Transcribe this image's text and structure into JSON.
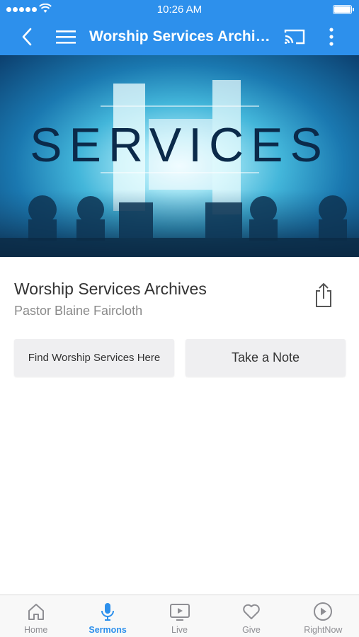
{
  "status_bar": {
    "time": "10:26 AM"
  },
  "navbar": {
    "title": "Worship Services Archives",
    "icons": [
      "back-chevron-icon",
      "hamburger-menu-icon",
      "cast-icon",
      "more-vertical-icon"
    ]
  },
  "hero": {
    "text": "SERVICES"
  },
  "content": {
    "title": "Worship Services Archives",
    "subtitle": "Pastor Blaine Faircloth",
    "share_icon": "share-icon"
  },
  "actions": {
    "find_label": "Find Worship Services Here",
    "note_label": "Take a Note"
  },
  "tabbar": {
    "tabs": [
      {
        "label": "Home",
        "icon": "home-icon",
        "active": false
      },
      {
        "label": "Sermons",
        "icon": "microphone-icon",
        "active": true
      },
      {
        "label": "Live",
        "icon": "tv-play-icon",
        "active": false
      },
      {
        "label": "Give",
        "icon": "heart-icon",
        "active": false
      },
      {
        "label": "RightNow",
        "icon": "play-circle-icon",
        "active": false
      }
    ],
    "active_color": "#2d90ec",
    "inactive_color": "#8e8e93"
  },
  "colors": {
    "header": "#2d90ec",
    "button_bg": "#efeff1"
  }
}
